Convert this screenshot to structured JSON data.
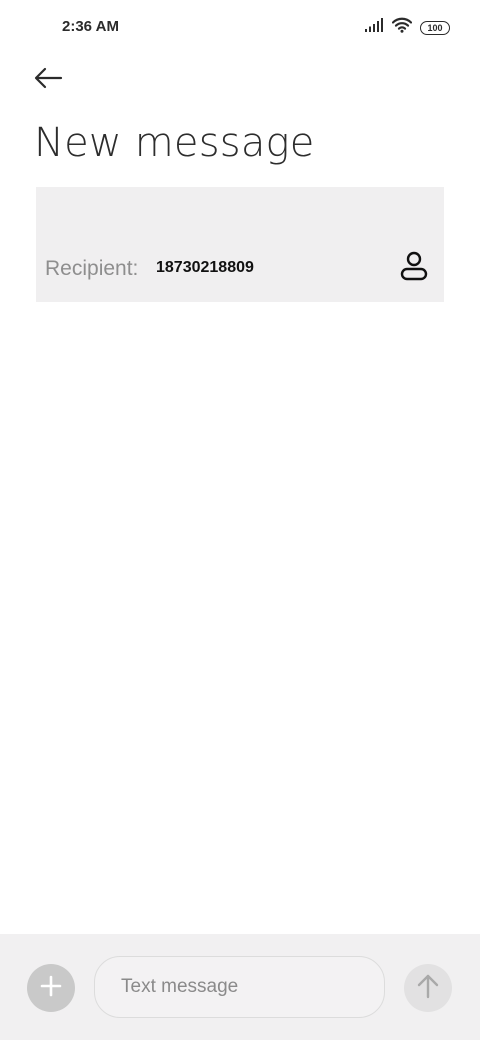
{
  "status_bar": {
    "time": "2:36 AM",
    "battery_level": "100",
    "icons": [
      "signal-icon",
      "wifi-icon",
      "battery-icon"
    ]
  },
  "header": {
    "back_icon": "arrow-left-icon",
    "title": "New message"
  },
  "recipient": {
    "label": "Recipient:",
    "value": "18730218809",
    "contact_icon": "person-icon"
  },
  "compose": {
    "attach_icon": "plus-icon",
    "input_value": "",
    "placeholder": "Text message",
    "send_icon": "arrow-up-icon"
  },
  "colors": {
    "panel_bg": "#f0eff0",
    "compose_bg": "#f1f0f1",
    "attach_bg": "#c9c9c9",
    "send_bg": "#e2e1e2"
  }
}
